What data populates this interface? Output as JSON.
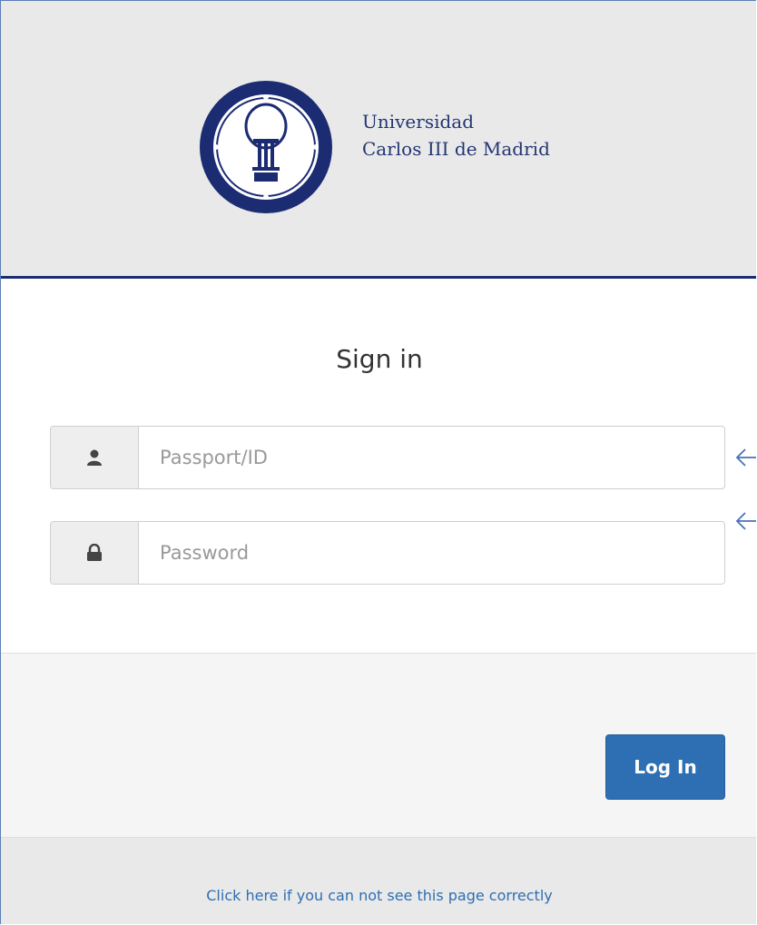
{
  "header": {
    "university_line1": "Universidad",
    "university_line2": "Carlos III de Madrid",
    "brand_color": "#1c2c73"
  },
  "form": {
    "title": "Sign in",
    "username": {
      "placeholder": "Passport/ID",
      "value": "",
      "icon": "user-icon"
    },
    "password": {
      "placeholder": "Password",
      "value": "",
      "icon": "lock-icon"
    }
  },
  "actions": {
    "login_label": "Log In",
    "button_color": "#2e6fb3"
  },
  "footer": {
    "help_link": "Click here if you can not see this page correctly"
  }
}
